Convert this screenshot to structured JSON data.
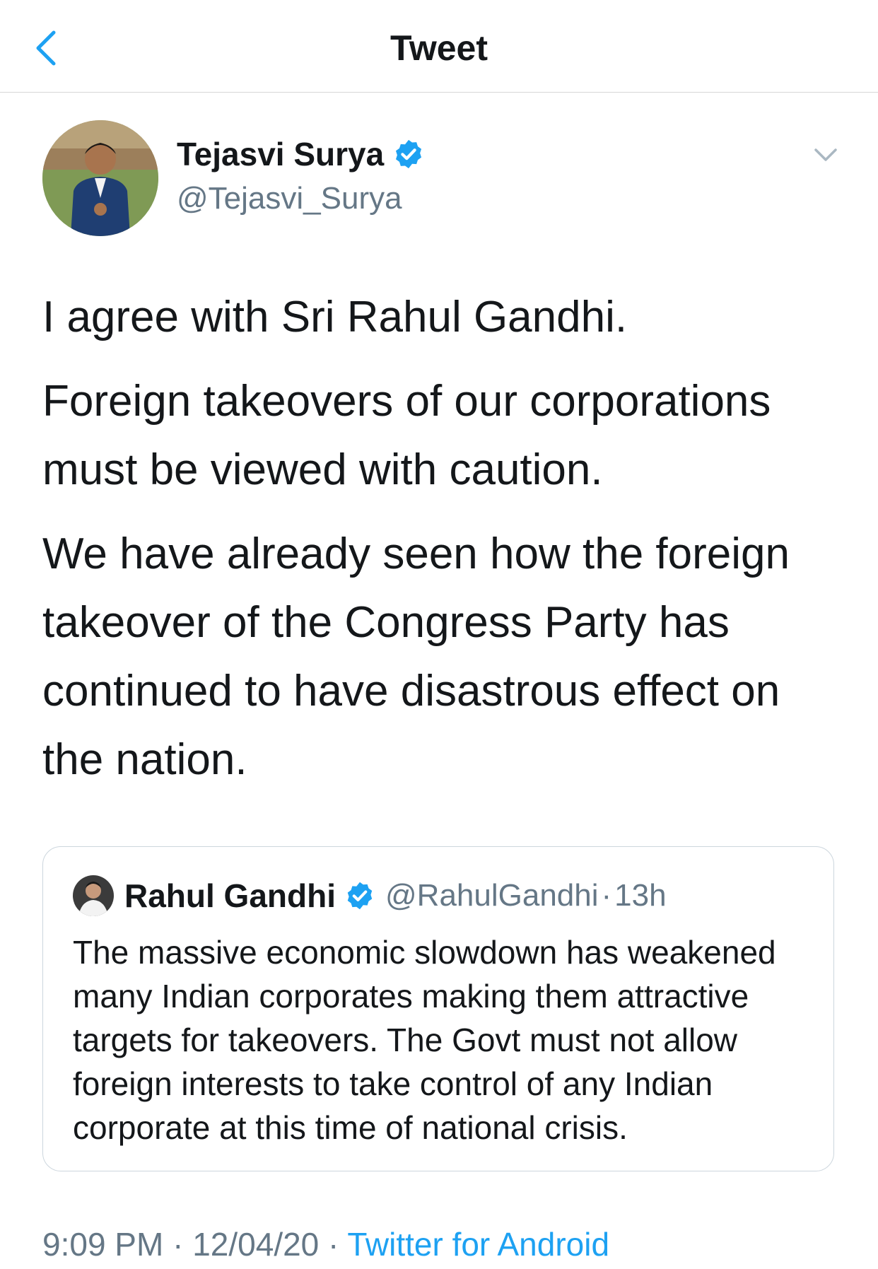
{
  "header": {
    "back_icon": "chevron-left-icon",
    "title": "Tweet"
  },
  "author": {
    "name": "Tejasvi Surya",
    "handle": "@Tejasvi_Surya",
    "verified_icon": "verified-badge-icon",
    "menu_icon": "chevron-down-icon"
  },
  "tweet": {
    "paragraphs": [
      "I agree with Sri Rahul Gandhi.",
      "Foreign takeovers of our corporations must be viewed with caution.",
      "We have already seen how the foreign takeover of the Congress Party has continued to have disastrous effect on the nation."
    ]
  },
  "quoted_tweet": {
    "name": "Rahul Gandhi",
    "handle": "@RahulGandhi",
    "separator": "·",
    "time_ago": "13h",
    "text": "The massive economic slowdown has weakened many Indian corporates making them attractive targets for takeovers. The Govt must not allow foreign interests to take control of any Indian corporate at this time of national crisis."
  },
  "footer": {
    "time": "9:09 PM",
    "separator": "·",
    "date": "12/04/20",
    "source": "Twitter for Android"
  },
  "colors": {
    "accent": "#1da1f2",
    "text": "#14171a",
    "secondary": "#657786",
    "border": "#ccd6dd"
  }
}
